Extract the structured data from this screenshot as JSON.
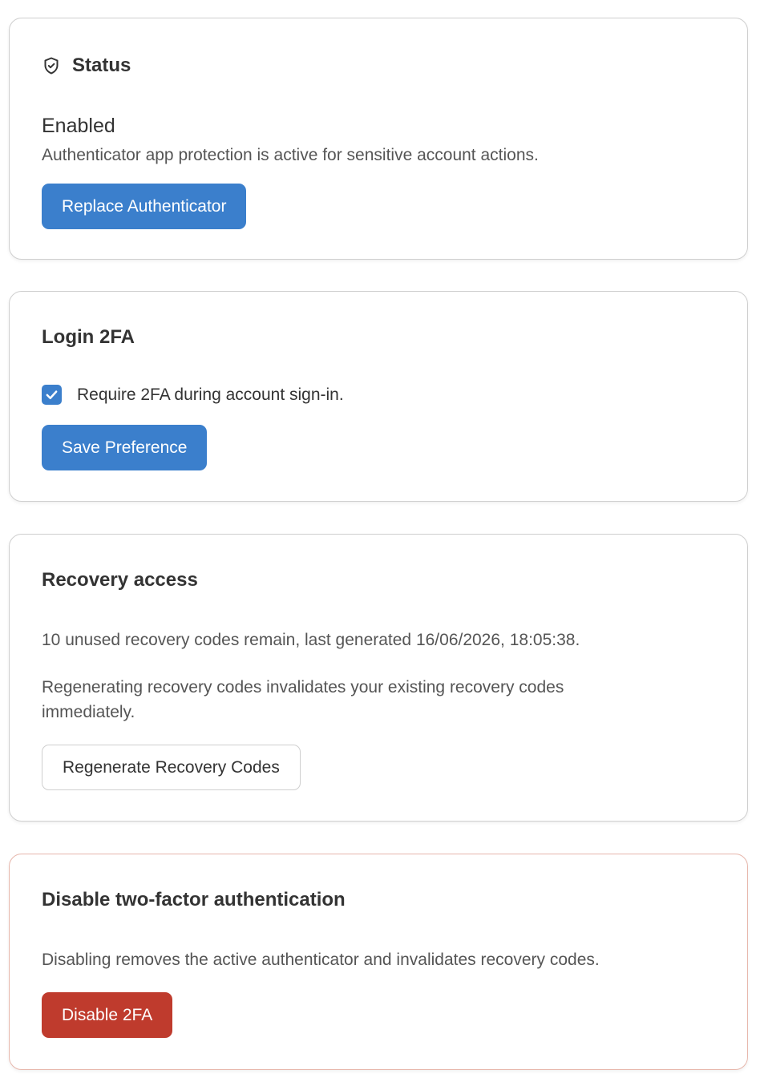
{
  "status": {
    "title": "Status",
    "state": "Enabled",
    "description": "Authenticator app protection is active for sensitive account actions.",
    "button": "Replace Authenticator"
  },
  "login": {
    "title": "Login 2FA",
    "checkbox_label": "Require 2FA during account sign-in.",
    "checked": true,
    "button": "Save Preference"
  },
  "recovery": {
    "title": "Recovery access",
    "summary": "10 unused recovery codes remain, last generated 16/06/2026, 18:05:38.",
    "warning": "Regenerating recovery codes invalidates your existing recovery codes immediately.",
    "button": "Regenerate Recovery Codes"
  },
  "disable": {
    "title": "Disable two-factor authentication",
    "description": "Disabling removes the active authenticator and invalidates recovery codes.",
    "button": "Disable 2FA"
  },
  "colors": {
    "primary": "#3b7fcc",
    "danger": "#bf3b2d",
    "danger_border": "#e7b7ac"
  },
  "icons": {
    "status": "shield-icon",
    "checkbox": "check-icon"
  }
}
